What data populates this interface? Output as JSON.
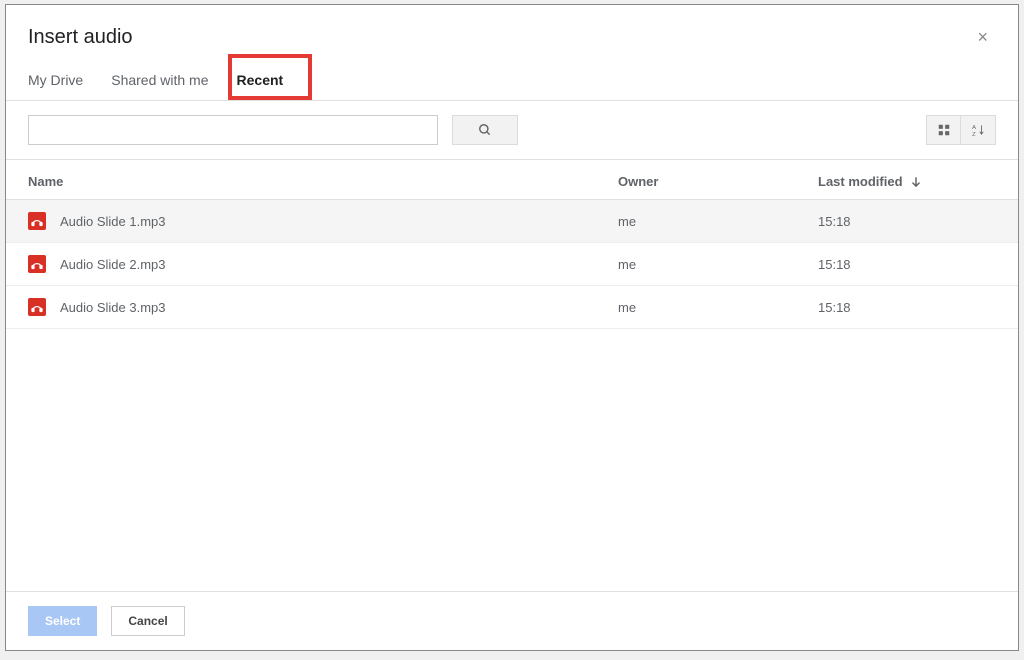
{
  "dialog": {
    "title": "Insert audio"
  },
  "tabs": [
    {
      "label": "My Drive",
      "active": false
    },
    {
      "label": "Shared with me",
      "active": false
    },
    {
      "label": "Recent",
      "active": true
    }
  ],
  "columns": {
    "name": "Name",
    "owner": "Owner",
    "modified": "Last modified"
  },
  "files": [
    {
      "name": "Audio Slide 1.mp3",
      "owner": "me",
      "modified": "15:18"
    },
    {
      "name": "Audio Slide 2.mp3",
      "owner": "me",
      "modified": "15:18"
    },
    {
      "name": "Audio Slide 3.mp3",
      "owner": "me",
      "modified": "15:18"
    }
  ],
  "footer": {
    "select": "Select",
    "cancel": "Cancel"
  },
  "search": {
    "value": ""
  }
}
